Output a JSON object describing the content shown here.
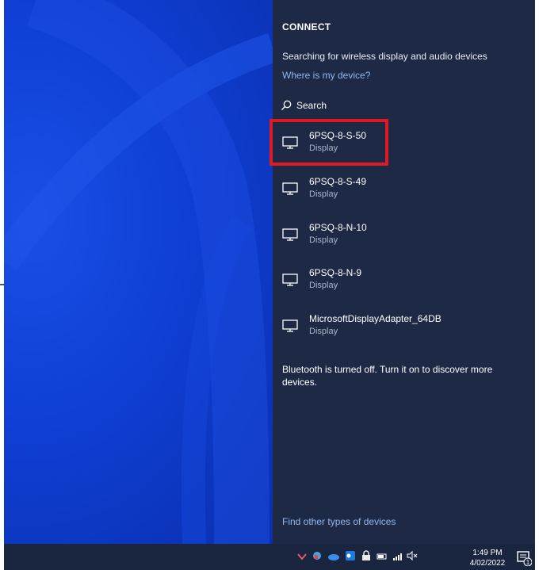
{
  "connect_panel": {
    "title": "CONNECT",
    "status": "Searching for wireless display and audio devices",
    "help_link": "Where is my device?",
    "search_label": "Search",
    "devices": [
      {
        "name": "6PSQ-8-S-50",
        "type": "Display",
        "highlighted": true
      },
      {
        "name": "6PSQ-8-S-49",
        "type": "Display"
      },
      {
        "name": "6PSQ-8-N-10",
        "type": "Display"
      },
      {
        "name": "6PSQ-8-N-9",
        "type": "Display"
      },
      {
        "name": "MicrosoftDisplayAdapter_64DB",
        "type": "Display"
      }
    ],
    "bluetooth_note": "Bluetooth is turned off. Turn it on to discover more devices.",
    "find_other_link": "Find other types of devices"
  },
  "taskbar": {
    "time": "1:49 PM",
    "date": "4/02/2022",
    "tray_icons": [
      "chevron-down-icon",
      "teams-icon",
      "onedrive-icon",
      "outlook-icon",
      "lock-icon",
      "battery-icon",
      "signal-icon",
      "volume-muted-icon"
    ],
    "notification_count": "1"
  },
  "colors": {
    "panel_bg": "#1e2a45",
    "desktop_blue": "#0f3fd4",
    "link": "#8fb8f2",
    "highlight": "#e01a22"
  }
}
